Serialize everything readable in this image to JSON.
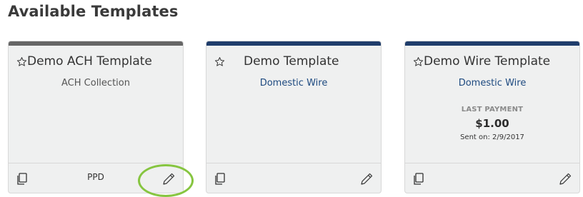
{
  "page_title": "Available Templates",
  "colors": {
    "card_bar_grey": "#666666",
    "card_bar_navy": "#1f3d6b",
    "link_blue": "#1e4a80",
    "highlight_green": "#86c540"
  },
  "icons": {
    "star": "star-outline-icon",
    "copy": "copy-icon",
    "edit": "pencil-icon"
  },
  "cards": [
    {
      "title": "Demo ACH Template",
      "type": "ACH Collection",
      "footer_label": "PPD"
    },
    {
      "title": "Demo Template",
      "type": "Domestic Wire"
    },
    {
      "title": "Demo Wire Template",
      "type": "Domestic Wire",
      "last_payment_label": "LAST PAYMENT",
      "last_payment_amount": "$1.00",
      "sent_on": "Sent on: 2/9/2017"
    }
  ]
}
